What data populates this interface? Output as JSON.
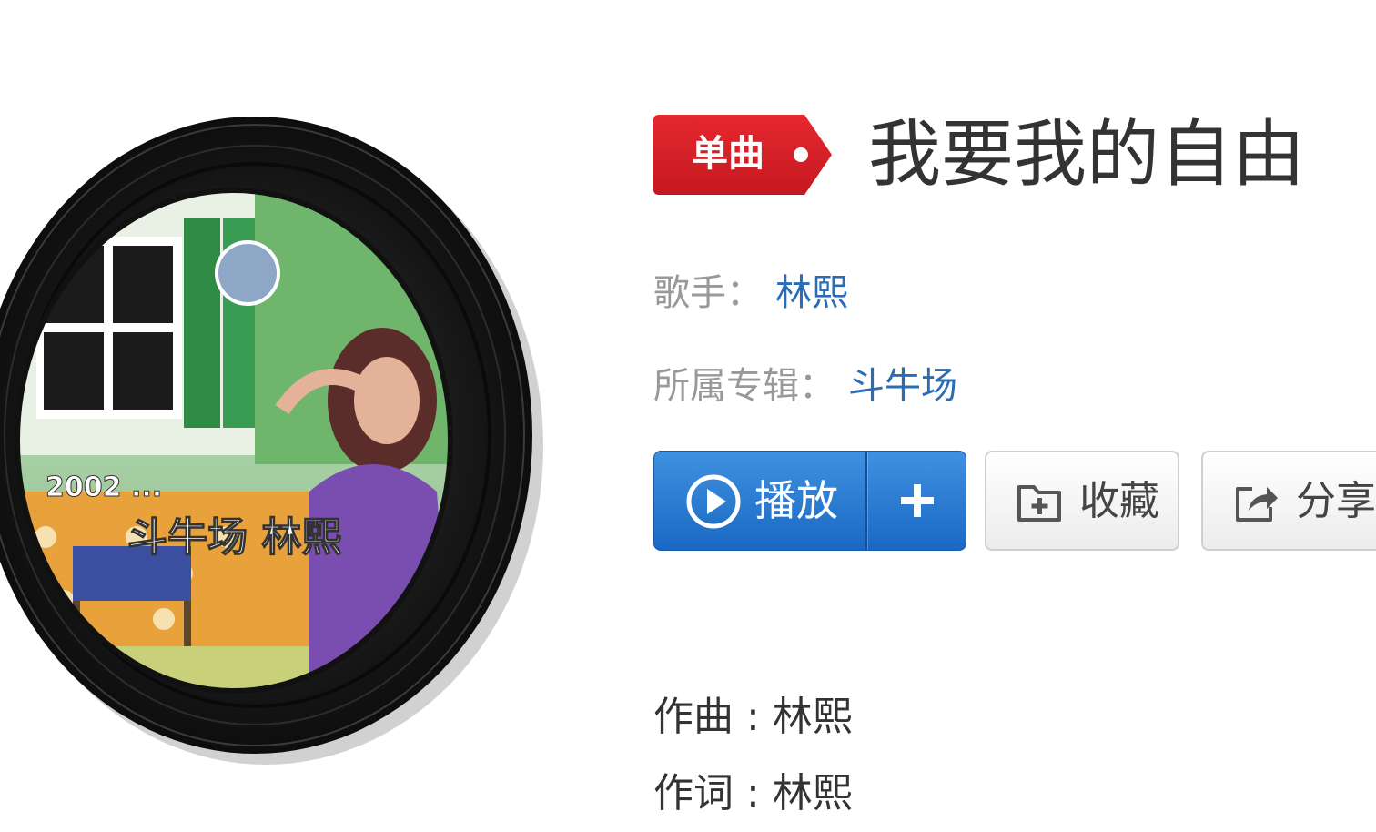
{
  "song": {
    "badge": "单曲",
    "title": "我要我的自由"
  },
  "meta": {
    "singer_label": "歌手：",
    "singer": "林熙",
    "album_label": "所属专辑：",
    "album": "斗牛场"
  },
  "actions": {
    "play_label": "播放",
    "add_icon": "plus-icon",
    "collect_label": "收藏",
    "share_label": "分享"
  },
  "credits": {
    "composer": "作曲 : 林熙",
    "lyricist": "作词 : 林熙"
  },
  "cover_art": {
    "text_small": "2002 ...",
    "text_large": "斗牛场 林熙"
  },
  "colors": {
    "badge_red": "#d8202a",
    "link_blue": "#2a6db5",
    "play_blue": "#2a7bd2",
    "text_dark": "#333333",
    "text_gray": "#999999"
  }
}
